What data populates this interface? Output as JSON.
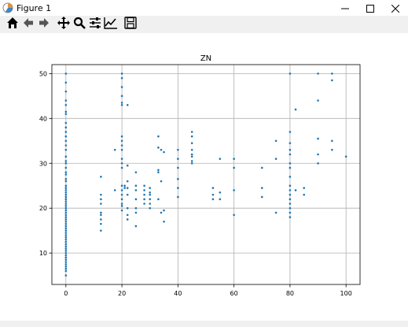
{
  "window": {
    "title": "Figure 1",
    "icons": {
      "app": "matplotlib-icon",
      "minimize": "minimize-icon",
      "maximize": "maximize-icon",
      "close": "close-icon"
    }
  },
  "toolbar": {
    "buttons": [
      {
        "icon": "home-icon"
      },
      {
        "icon": "back-arrow-icon"
      },
      {
        "icon": "forward-arrow-icon"
      },
      {
        "icon": "pan-icon"
      },
      {
        "icon": "zoom-icon"
      },
      {
        "icon": "configure-subplots-icon"
      },
      {
        "icon": "edit-axis-icon"
      },
      {
        "icon": "save-icon"
      }
    ]
  },
  "chart_data": {
    "type": "scatter",
    "title": "ZN",
    "xlabel": "",
    "ylabel": "",
    "xlim": [
      -5,
      105
    ],
    "ylim": [
      3,
      52
    ],
    "xticks": [
      0,
      20,
      40,
      60,
      80,
      100
    ],
    "yticks": [
      10,
      20,
      30,
      40,
      50
    ],
    "grid": true,
    "marker_color": "#1f77b4",
    "series": [
      {
        "points": [
          [
            0,
            5
          ],
          [
            0,
            6
          ],
          [
            0,
            6.5
          ],
          [
            0,
            7
          ],
          [
            0,
            7.5
          ],
          [
            0,
            8
          ],
          [
            0,
            8.5
          ],
          [
            0,
            9
          ],
          [
            0,
            9.5
          ],
          [
            0,
            10
          ],
          [
            0,
            10.5
          ],
          [
            0,
            11
          ],
          [
            0,
            11.5
          ],
          [
            0,
            12
          ],
          [
            0,
            12.5
          ],
          [
            0,
            13
          ],
          [
            0,
            13.5
          ],
          [
            0,
            14
          ],
          [
            0,
            14.5
          ],
          [
            0,
            15
          ],
          [
            0,
            15.5
          ],
          [
            0,
            16
          ],
          [
            0,
            16.5
          ],
          [
            0,
            17
          ],
          [
            0,
            17.5
          ],
          [
            0,
            18
          ],
          [
            0,
            18.5
          ],
          [
            0,
            19
          ],
          [
            0,
            19.5
          ],
          [
            0,
            20
          ],
          [
            0,
            20.5
          ],
          [
            0,
            21
          ],
          [
            0,
            21.5
          ],
          [
            0,
            22
          ],
          [
            0,
            22.5
          ],
          [
            0,
            23
          ],
          [
            0,
            23.5
          ],
          [
            0,
            24
          ],
          [
            0,
            24.5
          ],
          [
            0,
            25
          ],
          [
            0,
            26
          ],
          [
            0,
            26.5
          ],
          [
            0,
            27.5
          ],
          [
            0,
            28
          ],
          [
            0,
            29
          ],
          [
            0,
            30
          ],
          [
            0,
            30.5
          ],
          [
            0,
            31.5
          ],
          [
            0,
            33
          ],
          [
            0,
            34
          ],
          [
            0,
            35
          ],
          [
            0,
            36
          ],
          [
            0,
            37
          ],
          [
            0,
            38
          ],
          [
            0,
            39
          ],
          [
            0,
            41
          ],
          [
            0,
            41.5
          ],
          [
            0,
            43
          ],
          [
            0,
            44
          ],
          [
            0,
            46
          ],
          [
            0,
            48
          ],
          [
            0,
            50
          ],
          [
            12.5,
            15
          ],
          [
            12.5,
            16.5
          ],
          [
            12.5,
            17.5
          ],
          [
            12.5,
            18.5
          ],
          [
            12.5,
            19
          ],
          [
            12.5,
            21
          ],
          [
            12.5,
            22
          ],
          [
            12.5,
            23
          ],
          [
            12.5,
            27
          ],
          [
            17.5,
            24
          ],
          [
            17.5,
            33
          ],
          [
            20,
            19.5
          ],
          [
            20,
            20.5
          ],
          [
            20,
            21
          ],
          [
            20,
            22
          ],
          [
            20,
            23
          ],
          [
            20,
            24
          ],
          [
            20,
            25
          ],
          [
            20,
            29
          ],
          [
            20,
            30
          ],
          [
            20,
            31
          ],
          [
            20,
            33
          ],
          [
            20,
            34
          ],
          [
            20,
            35
          ],
          [
            20,
            36
          ],
          [
            20,
            43
          ],
          [
            20,
            43.5
          ],
          [
            20,
            45
          ],
          [
            20,
            47
          ],
          [
            20,
            49
          ],
          [
            20,
            50
          ],
          [
            21,
            24.5
          ],
          [
            21,
            25
          ],
          [
            22,
            17.5
          ],
          [
            22,
            18.5
          ],
          [
            22,
            20
          ],
          [
            22,
            23
          ],
          [
            22,
            24.5
          ],
          [
            22,
            26
          ],
          [
            22,
            29.5
          ],
          [
            22,
            43
          ],
          [
            25,
            16
          ],
          [
            25,
            19
          ],
          [
            25,
            20
          ],
          [
            25,
            22
          ],
          [
            25,
            24
          ],
          [
            25,
            25
          ],
          [
            25,
            28
          ],
          [
            28,
            21
          ],
          [
            28,
            22
          ],
          [
            28,
            23
          ],
          [
            28,
            24
          ],
          [
            28,
            25
          ],
          [
            30,
            20
          ],
          [
            30,
            21
          ],
          [
            30,
            22
          ],
          [
            30,
            23
          ],
          [
            30,
            23.5
          ],
          [
            30,
            24.5
          ],
          [
            33,
            22
          ],
          [
            33,
            28
          ],
          [
            33,
            28.5
          ],
          [
            33,
            33.5
          ],
          [
            33,
            36
          ],
          [
            34,
            19
          ],
          [
            34,
            26
          ],
          [
            34,
            33
          ],
          [
            35,
            17
          ],
          [
            35,
            19.5
          ],
          [
            35,
            32.5
          ],
          [
            40,
            22.5
          ],
          [
            40,
            24.5
          ],
          [
            40,
            26.5
          ],
          [
            40,
            29
          ],
          [
            40,
            31
          ],
          [
            40,
            33
          ],
          [
            45,
            30
          ],
          [
            45,
            30.5
          ],
          [
            45,
            31.5
          ],
          [
            45,
            32
          ],
          [
            45,
            33
          ],
          [
            45,
            34.5
          ],
          [
            45,
            36
          ],
          [
            45,
            37
          ],
          [
            52.5,
            22
          ],
          [
            52.5,
            23
          ],
          [
            52.5,
            24.5
          ],
          [
            55,
            22
          ],
          [
            55,
            23.5
          ],
          [
            55,
            31
          ],
          [
            60,
            18.5
          ],
          [
            60,
            24
          ],
          [
            60,
            29
          ],
          [
            60,
            31
          ],
          [
            70,
            22.5
          ],
          [
            70,
            24.5
          ],
          [
            70,
            29
          ],
          [
            75,
            19
          ],
          [
            75,
            31
          ],
          [
            75,
            35
          ],
          [
            80,
            18
          ],
          [
            80,
            19
          ],
          [
            80,
            20
          ],
          [
            80,
            21
          ],
          [
            80,
            22
          ],
          [
            80,
            23
          ],
          [
            80,
            24
          ],
          [
            80,
            25
          ],
          [
            80,
            27
          ],
          [
            80,
            29
          ],
          [
            80,
            30
          ],
          [
            80,
            32
          ],
          [
            80,
            33
          ],
          [
            80,
            34.5
          ],
          [
            80,
            37
          ],
          [
            80,
            50
          ],
          [
            82,
            24
          ],
          [
            82,
            42
          ],
          [
            85,
            23
          ],
          [
            85,
            24.5
          ],
          [
            90,
            30
          ],
          [
            90,
            32
          ],
          [
            90,
            35.5
          ],
          [
            90,
            44
          ],
          [
            90,
            50
          ],
          [
            95,
            33
          ],
          [
            95,
            35
          ],
          [
            95,
            48.5
          ],
          [
            95,
            50
          ],
          [
            100,
            31.5
          ]
        ]
      }
    ]
  }
}
